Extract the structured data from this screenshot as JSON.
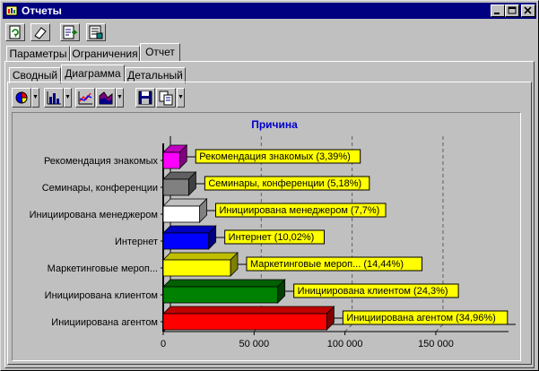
{
  "window": {
    "title": "Отчеты"
  },
  "tabs_top": [
    {
      "label": "Параметры"
    },
    {
      "label": "Ограничения"
    },
    {
      "label": "Отчет"
    }
  ],
  "tabs_sub": [
    {
      "label": "Сводный"
    },
    {
      "label": "Диаграмма"
    },
    {
      "label": "Детальный"
    }
  ],
  "icons": {
    "refresh": "refresh-icon",
    "erase": "eraser-icon",
    "export": "export-icon",
    "report": "report-icon",
    "pie": "pie-chart-icon",
    "bar": "bar-chart-icon",
    "line": "line-chart-icon",
    "area": "area-chart-icon",
    "save": "save-icon",
    "copy": "copy-icon"
  },
  "colors": {
    "titlebar": "#000080",
    "label_bg": "#ffff00"
  },
  "chart_data": {
    "type": "bar",
    "orientation": "horizontal",
    "title": "Причина",
    "categories": [
      "Рекомендация знакомых",
      "Семинары, конференции",
      "Инициирована менеджером",
      "Интернет",
      "Маркетинговые мероп...",
      "Инициирована клиентом",
      "Инициирована агентом"
    ],
    "values": [
      9000,
      14000,
      20000,
      25000,
      37000,
      63000,
      90000
    ],
    "data_labels": [
      "Рекомендация знакомых (3,39%)",
      "Семинары, конференции (5,18%)",
      "Инициирована менеджером (7,7%)",
      "Интернет (10,02%)",
      "Маркетинговые мероп... (14,44%)",
      "Инициирована клиентом (24,3%)",
      "Инициирована агентом (34,96%)"
    ],
    "colors": [
      "#ff00ff",
      "#808080",
      "#ffffff",
      "#0000ff",
      "#ffff00",
      "#008000",
      "#ff0000"
    ],
    "xlim": [
      0,
      190000
    ],
    "xticks": [
      0,
      50000,
      100000,
      150000
    ],
    "xtick_labels": [
      "0",
      "50 000",
      "100 000",
      "150 000"
    ],
    "grid": true
  }
}
